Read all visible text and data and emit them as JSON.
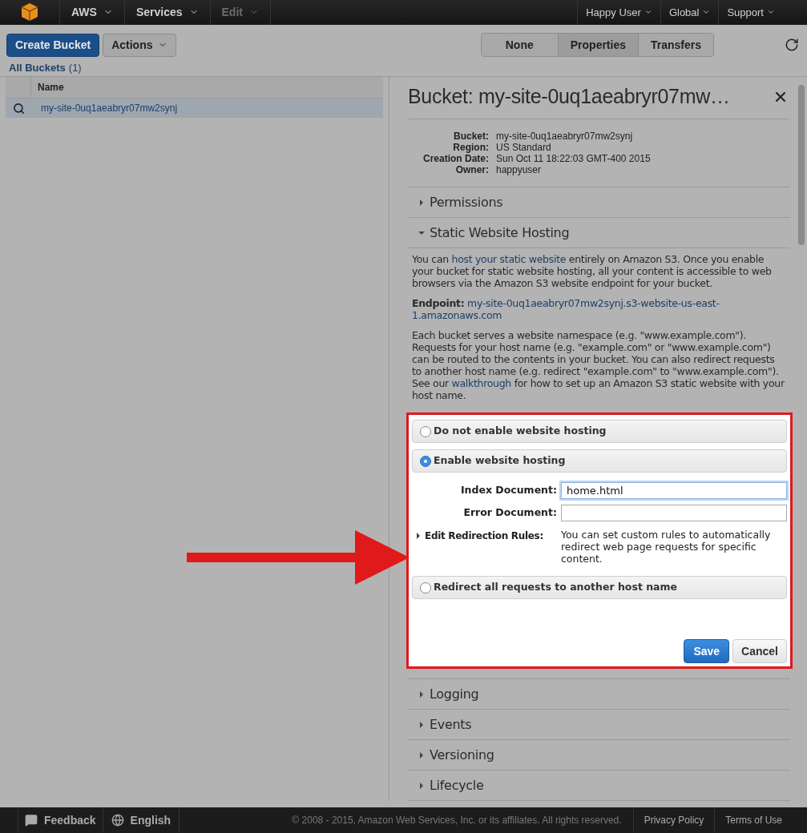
{
  "nav": {
    "left": [
      {
        "label": "AWS",
        "disabled": false
      },
      {
        "label": "Services",
        "disabled": false
      },
      {
        "label": "Edit",
        "disabled": true
      }
    ],
    "right": [
      "Happy User",
      "Global",
      "Support"
    ]
  },
  "toolbar": {
    "create_button": "Create Bucket",
    "actions_button": "Actions",
    "view_tabs": [
      {
        "label": "None",
        "selected": false
      },
      {
        "label": "Properties",
        "selected": true
      },
      {
        "label": "Transfers",
        "selected": false
      }
    ]
  },
  "breadcrumb": {
    "label": "All Buckets",
    "count": "(1)"
  },
  "table": {
    "columns": [
      "Name"
    ],
    "rows": [
      {
        "name": "my-site-0uq1aeabryr07mw2synj",
        "selected": true
      }
    ]
  },
  "details": {
    "title": "Bucket: my-site-0uq1aeabryr07mw…",
    "properties": [
      {
        "label": "Bucket:",
        "value": "my-site-0uq1aeabryr07mw2synj"
      },
      {
        "label": "Region:",
        "value": "US Standard"
      },
      {
        "label": "Creation Date:",
        "value": "Sun Oct 11 18:22:03 GMT-400 2015"
      },
      {
        "label": "Owner:",
        "value": "happyuser"
      }
    ],
    "sections": [
      {
        "title": "Permissions",
        "expanded": false
      },
      {
        "title": "Static Website Hosting",
        "expanded": true
      },
      {
        "title": "Logging",
        "expanded": false
      },
      {
        "title": "Events",
        "expanded": false
      },
      {
        "title": "Versioning",
        "expanded": false
      },
      {
        "title": "Lifecycle",
        "expanded": false
      }
    ]
  },
  "hosting": {
    "intro": {
      "before": "You can ",
      "link": "host your static website",
      "after": " entirely on Amazon S3. Once you enable your bucket for static website hosting, all your content is accessible to web browsers via the Amazon S3 website endpoint for your bucket."
    },
    "endpoint": {
      "label": "Endpoint:",
      "value": "my-site-0uq1aeabryr07mw2synj.s3-website-us-east-1.amazonaws.com"
    },
    "namespace": {
      "before": "Each bucket serves a website namespace (e.g. \"www.example.com\"). Requests for your host name (e.g. \"example.com\" or \"www.example.com\") can be routed to the contents in your bucket. You can also redirect requests to another host name (e.g. redirect \"example.com\" to \"www.example.com\"). See our ",
      "link": "walkthrough",
      "after": " for how to set up an Amazon S3 static website with your host name."
    },
    "options": [
      {
        "label": "Do not enable website hosting",
        "selected": false
      },
      {
        "label": "Enable website hosting",
        "selected": true
      },
      {
        "label": "Redirect all requests to another host name",
        "selected": false
      }
    ],
    "fields": [
      {
        "label": "Index Document:",
        "value": "home.html",
        "focused": true
      },
      {
        "label": "Error Document:",
        "focused": false
      }
    ],
    "rules": {
      "label": "Edit Redirection Rules:",
      "text": "You can set custom rules to automatically redirect web page requests for specific content.",
      "expanded": false
    },
    "buttons": [
      {
        "label": "Save",
        "kind": "primary"
      },
      {
        "label": "Cancel",
        "kind": "secondary"
      }
    ]
  },
  "footer": {
    "feedback": "Feedback",
    "language": "English",
    "copyright": "© 2008 - 2015, Amazon Web Services, Inc. or its affiliates. All rights reserved.",
    "links": [
      "Privacy Policy",
      "Terms of Use"
    ]
  }
}
